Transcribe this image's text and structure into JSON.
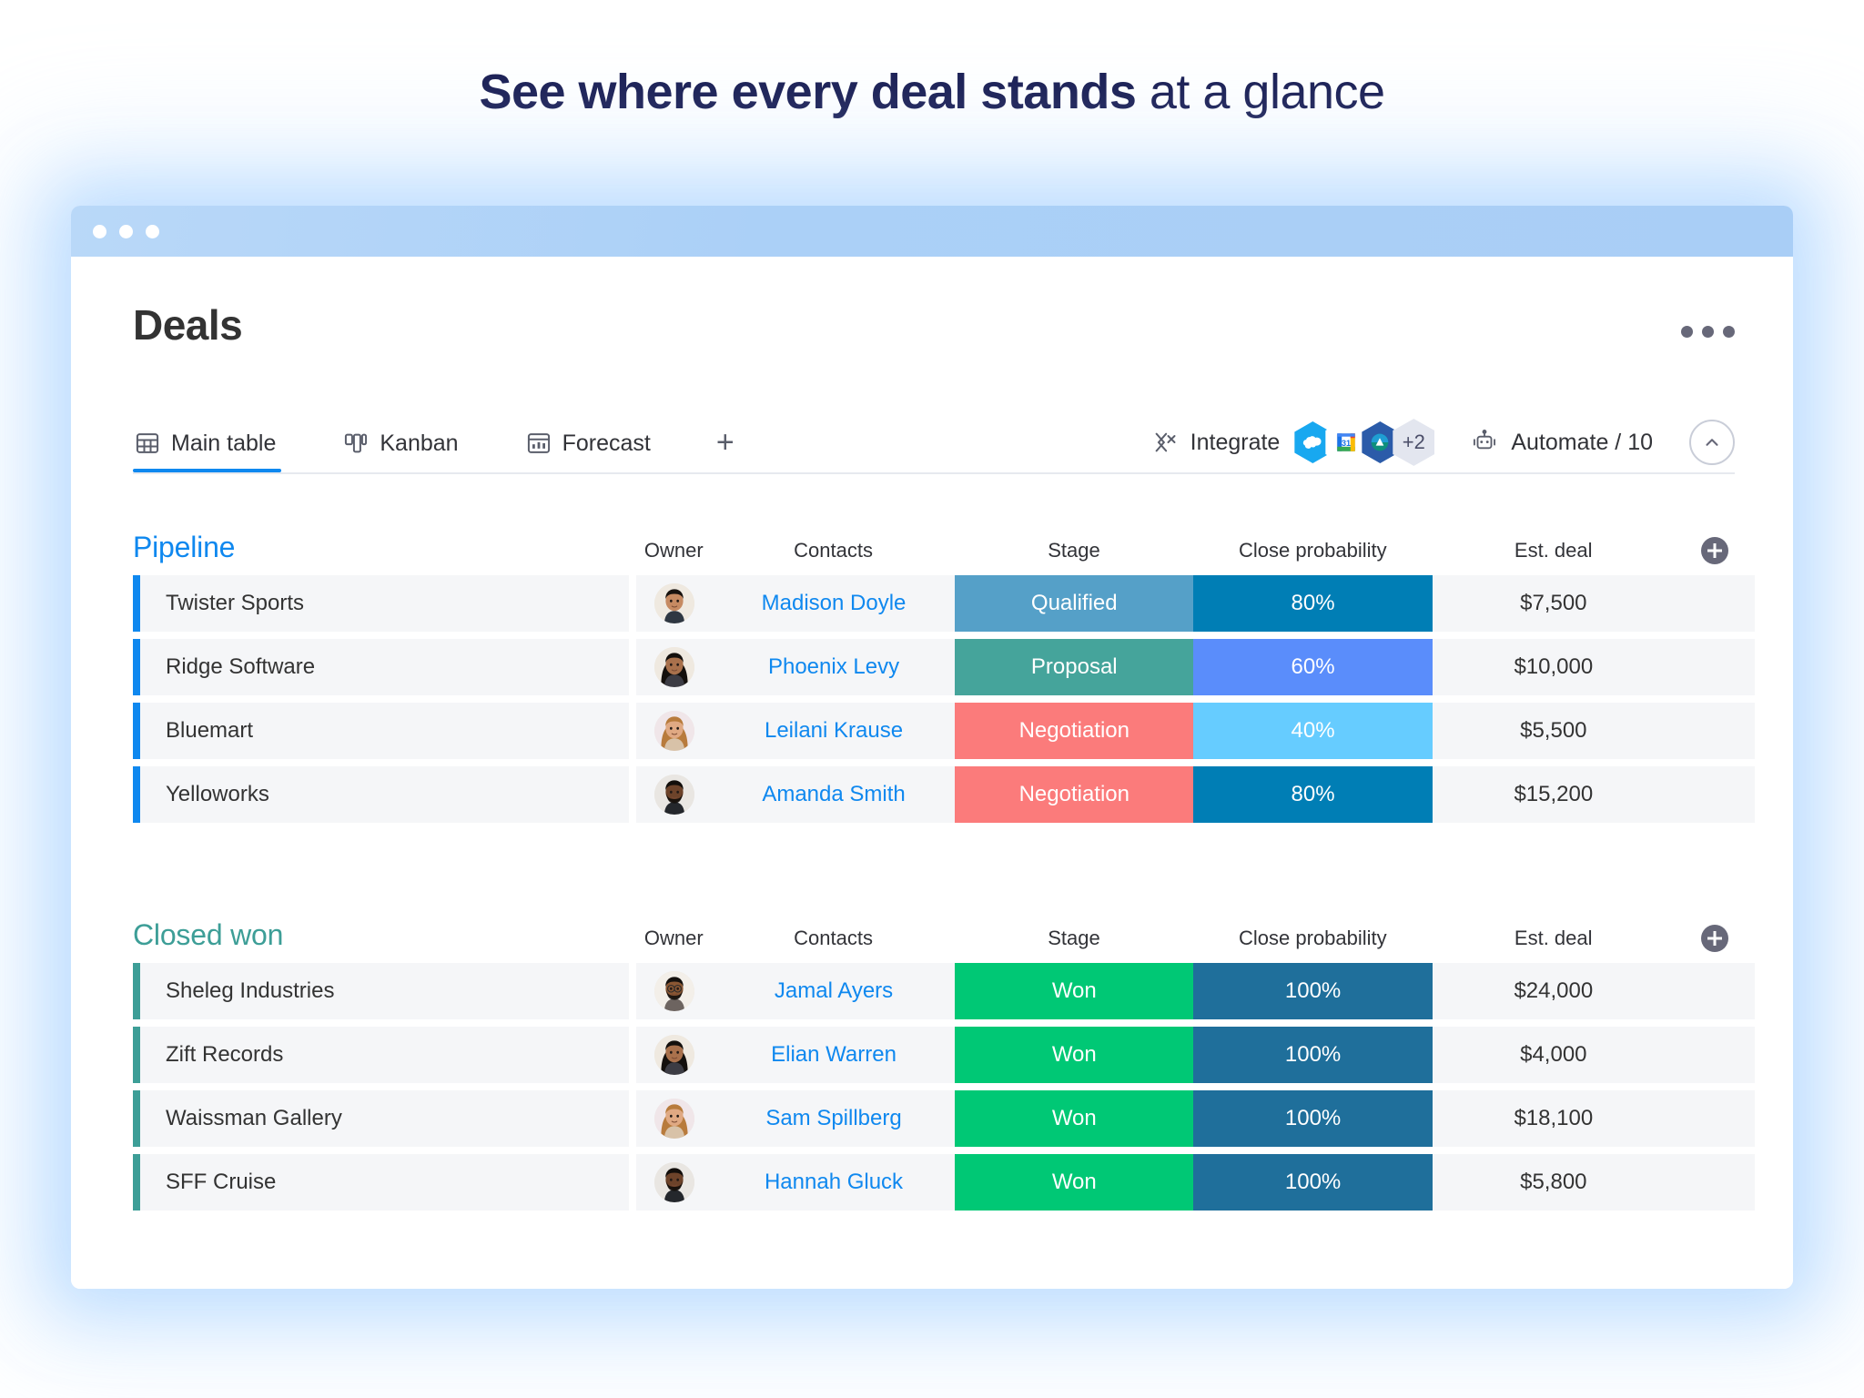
{
  "headline": {
    "strong": "See where every deal stands",
    "light": " at a glance"
  },
  "window": {
    "dots_count": 3
  },
  "app": {
    "page_title": "Deals",
    "more_menu_label": "…"
  },
  "tabs": [
    {
      "label": "Main table",
      "icon": "table-icon",
      "active": true
    },
    {
      "label": "Kanban",
      "icon": "kanban-icon",
      "active": false
    },
    {
      "label": "Forecast",
      "icon": "forecast-chart-icon",
      "active": false
    }
  ],
  "tab_add_label": "+",
  "toolbar": {
    "integrate_label": "Integrate",
    "integration_overflow": "+2",
    "integrations": [
      {
        "name": "salesforce-icon",
        "color": "#18a8f0"
      },
      {
        "name": "google-calendar-icon",
        "color": "#ffffff"
      },
      {
        "name": "google-drive-icon",
        "color": "#2b5ba9"
      }
    ],
    "automate_label": "Automate / 10",
    "collapse_label": "collapse"
  },
  "columns": {
    "owner": "Owner",
    "contacts": "Contacts",
    "stage": "Stage",
    "close_probability": "Close probability",
    "est_deal": "Est. deal"
  },
  "groups": [
    {
      "id": "pipeline",
      "title": "Pipeline",
      "color": "#0f88ef",
      "rows": [
        {
          "name": "Twister Sports",
          "contact": "Madison Doyle",
          "stage": "Qualified",
          "stage_color": "#55a0c8",
          "probability": "80%",
          "probability_color": "#007eb5",
          "est_deal": "$7,500",
          "avatar": "avatar-man-dark-hair"
        },
        {
          "name": "Ridge Software",
          "contact": "Phoenix Levy",
          "stage": "Proposal",
          "stage_color": "#45a49b",
          "probability": "60%",
          "probability_color": "#5a8dfb",
          "est_deal": "$10,000",
          "avatar": "avatar-woman-dark-hair"
        },
        {
          "name": "Bluemart",
          "contact": "Leilani Krause",
          "stage": "Negotiation",
          "stage_color": "#fb7b7b",
          "probability": "40%",
          "probability_color": "#66ccff",
          "est_deal": "$5,500",
          "avatar": "avatar-woman-blonde"
        },
        {
          "name": "Yelloworks",
          "contact": "Amanda Smith",
          "stage": "Negotiation",
          "stage_color": "#fb7b7b",
          "probability": "80%",
          "probability_color": "#007eb5",
          "est_deal": "$15,200",
          "avatar": "avatar-man-beard"
        }
      ]
    },
    {
      "id": "closed-won",
      "title": "Closed won",
      "color": "#3d9e97",
      "rows": [
        {
          "name": "Sheleg Industries",
          "contact": "Jamal Ayers",
          "stage": "Won",
          "stage_color": "#00c875",
          "probability": "100%",
          "probability_color": "#1f6f9b",
          "est_deal": "$24,000",
          "avatar": "avatar-man-glasses"
        },
        {
          "name": "Zift Records",
          "contact": "Elian Warren",
          "stage": "Won",
          "stage_color": "#00c875",
          "probability": "100%",
          "probability_color": "#1f6f9b",
          "est_deal": "$4,000",
          "avatar": "avatar-woman-dark-hair"
        },
        {
          "name": "Waissman Gallery",
          "contact": "Sam Spillberg",
          "stage": "Won",
          "stage_color": "#00c875",
          "probability": "100%",
          "probability_color": "#1f6f9b",
          "est_deal": "$18,100",
          "avatar": "avatar-woman-blonde"
        },
        {
          "name": "SFF Cruise",
          "contact": "Hannah Gluck",
          "stage": "Won",
          "stage_color": "#00c875",
          "probability": "100%",
          "probability_color": "#1f6f9b",
          "est_deal": "$5,800",
          "avatar": "avatar-man-beard"
        }
      ]
    }
  ]
}
